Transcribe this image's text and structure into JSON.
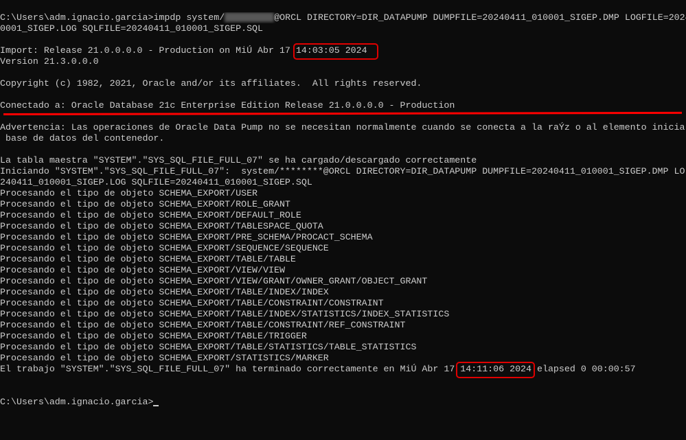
{
  "terminal": {
    "prompt": "C:\\Users\\adm.ignacio.garcia>",
    "command_before_password": "impdp system/",
    "command_after_password": "@ORCL DIRECTORY=DIR_DATAPUMP DUMPFILE=20240411_010001_SIGEP.DMP LOGFILE=2024",
    "command_wrap": "0001_SIGEP.LOG SQLFILE=20240411_010001_SIGEP.SQL",
    "import_prefix": "Import: Release 21.0.0.0.0 - Production on MiÚ Abr 17 ",
    "import_time": "14:03:05 2024",
    "version": "Version 21.3.0.0.0",
    "copyright": "Copyright (c) 1982, 2021, Oracle and/or its affiliates.  All rights reserved.",
    "connected": "Conectado a: Oracle Database 21c Enterprise Edition Release 21.0.0.0.0 - Production",
    "warning_1": "Advertencia: Las operaciones de Oracle Data Pump no se necesitan normalmente cuando se conecta a la raÝz o al elemento inicia",
    "warning_2": " base de datos del contenedor.",
    "master_table": "La tabla maestra \"SYSTEM\".\"SYS_SQL_FILE_FULL_07\" se ha cargado/descargado correctamente",
    "starting_1": "Iniciando \"SYSTEM\".\"SYS_SQL_FILE_FULL_07\":  system/********@ORCL DIRECTORY=DIR_DATAPUMP DUMPFILE=20240411_010001_SIGEP.DMP LO",
    "starting_2": "240411_010001_SIGEP.LOG SQLFILE=20240411_010001_SIGEP.SQL",
    "processing": [
      "Procesando el tipo de objeto SCHEMA_EXPORT/USER",
      "Procesando el tipo de objeto SCHEMA_EXPORT/ROLE_GRANT",
      "Procesando el tipo de objeto SCHEMA_EXPORT/DEFAULT_ROLE",
      "Procesando el tipo de objeto SCHEMA_EXPORT/TABLESPACE_QUOTA",
      "Procesando el tipo de objeto SCHEMA_EXPORT/PRE_SCHEMA/PROCACT_SCHEMA",
      "Procesando el tipo de objeto SCHEMA_EXPORT/SEQUENCE/SEQUENCE",
      "Procesando el tipo de objeto SCHEMA_EXPORT/TABLE/TABLE",
      "Procesando el tipo de objeto SCHEMA_EXPORT/VIEW/VIEW",
      "Procesando el tipo de objeto SCHEMA_EXPORT/VIEW/GRANT/OWNER_GRANT/OBJECT_GRANT",
      "Procesando el tipo de objeto SCHEMA_EXPORT/TABLE/INDEX/INDEX",
      "Procesando el tipo de objeto SCHEMA_EXPORT/TABLE/CONSTRAINT/CONSTRAINT",
      "Procesando el tipo de objeto SCHEMA_EXPORT/TABLE/INDEX/STATISTICS/INDEX_STATISTICS",
      "Procesando el tipo de objeto SCHEMA_EXPORT/TABLE/CONSTRAINT/REF_CONSTRAINT",
      "Procesando el tipo de objeto SCHEMA_EXPORT/TABLE/TRIGGER",
      "Procesando el tipo de objeto SCHEMA_EXPORT/TABLE/STATISTICS/TABLE_STATISTICS",
      "Procesando el tipo de objeto SCHEMA_EXPORT/STATISTICS/MARKER"
    ],
    "finished_prefix": "El trabajo \"SYSTEM\".\"SYS_SQL_FILE_FULL_07\" ha terminado correctamente en MiÚ Abr 17 ",
    "finished_time": "14:11:06 2024",
    "finished_suffix": " elapsed 0 00:00:57"
  },
  "colors": {
    "background": "#0c0c0c",
    "text": "#cccccc",
    "annotation": "#e00000"
  }
}
